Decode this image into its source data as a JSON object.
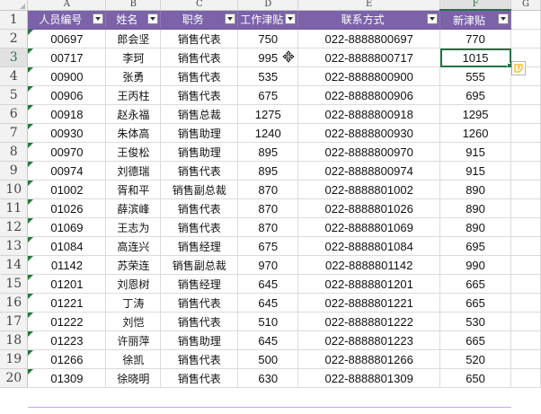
{
  "columns": {
    "letters": [
      "A",
      "B",
      "C",
      "D",
      "E",
      "F",
      "G"
    ],
    "active": "F"
  },
  "headers": {
    "id": "人员编号",
    "name": "姓名",
    "title": "职务",
    "allowance": "工作津贴",
    "contact": "联系方式",
    "new_allowance": "新津贴"
  },
  "row_numbers": [
    "1",
    "2",
    "3",
    "4",
    "5",
    "6",
    "7",
    "8",
    "9",
    "10",
    "11",
    "12",
    "13",
    "14",
    "15",
    "16",
    "17",
    "18",
    "19",
    "20"
  ],
  "active_row": "3",
  "rows": [
    {
      "id": "00697",
      "name": "郎会坚",
      "title": "销售代表",
      "allowance": "750",
      "contact": "022-8888800697",
      "new_allowance": "770"
    },
    {
      "id": "00717",
      "name": "李珂",
      "title": "销售代表",
      "allowance": "995",
      "contact": "022-8888800717",
      "new_allowance": "1015"
    },
    {
      "id": "00900",
      "name": "张勇",
      "title": "销售代表",
      "allowance": "535",
      "contact": "022-8888800900",
      "new_allowance": "555"
    },
    {
      "id": "00906",
      "name": "王丙柱",
      "title": "销售代表",
      "allowance": "675",
      "contact": "022-8888800906",
      "new_allowance": "695"
    },
    {
      "id": "00918",
      "name": "赵永福",
      "title": "销售总裁",
      "allowance": "1275",
      "contact": "022-8888800918",
      "new_allowance": "1295"
    },
    {
      "id": "00930",
      "name": "朱体高",
      "title": "销售助理",
      "allowance": "1240",
      "contact": "022-8888800930",
      "new_allowance": "1260"
    },
    {
      "id": "00970",
      "name": "王俊松",
      "title": "销售助理",
      "allowance": "895",
      "contact": "022-8888800970",
      "new_allowance": "915"
    },
    {
      "id": "00974",
      "name": "刘德瑞",
      "title": "销售代表",
      "allowance": "895",
      "contact": "022-8888800974",
      "new_allowance": "915"
    },
    {
      "id": "01002",
      "name": "胥和平",
      "title": "销售副总裁",
      "allowance": "870",
      "contact": "022-8888801002",
      "new_allowance": "890"
    },
    {
      "id": "01026",
      "name": "薛滨峰",
      "title": "销售代表",
      "allowance": "870",
      "contact": "022-8888801026",
      "new_allowance": "890"
    },
    {
      "id": "01069",
      "name": "王志为",
      "title": "销售代表",
      "allowance": "870",
      "contact": "022-8888801069",
      "new_allowance": "890"
    },
    {
      "id": "01084",
      "name": "高连兴",
      "title": "销售经理",
      "allowance": "675",
      "contact": "022-8888801084",
      "new_allowance": "695"
    },
    {
      "id": "01142",
      "name": "苏荣连",
      "title": "销售副总裁",
      "allowance": "970",
      "contact": "022-8888801142",
      "new_allowance": "990"
    },
    {
      "id": "01201",
      "name": "刘恩树",
      "title": "销售经理",
      "allowance": "645",
      "contact": "022-8888801201",
      "new_allowance": "665"
    },
    {
      "id": "01221",
      "name": "丁涛",
      "title": "销售代表",
      "allowance": "645",
      "contact": "022-8888801221",
      "new_allowance": "665"
    },
    {
      "id": "01222",
      "name": "刘恺",
      "title": "销售代表",
      "allowance": "510",
      "contact": "022-8888801222",
      "new_allowance": "530"
    },
    {
      "id": "01223",
      "name": "许丽萍",
      "title": "销售助理",
      "allowance": "645",
      "contact": "022-8888801223",
      "new_allowance": "665"
    },
    {
      "id": "01266",
      "name": "徐凯",
      "title": "销售代表",
      "allowance": "500",
      "contact": "022-8888801266",
      "new_allowance": "520"
    },
    {
      "id": "01309",
      "name": "徐晓明",
      "title": "销售代表",
      "allowance": "630",
      "contact": "022-8888801309",
      "new_allowance": "650"
    }
  ],
  "icons": {
    "filter": "filter-dropdown-icon",
    "cursor": "move-cursor-icon",
    "smart_tag": "error-options-icon",
    "corner": "select-all-icon"
  },
  "colors": {
    "header_fill": "#7b62a9",
    "header_text": "#ffffff",
    "selection": "#217346",
    "error_triangle": "#1e7b34",
    "smart_tag": "#f5b400"
  }
}
